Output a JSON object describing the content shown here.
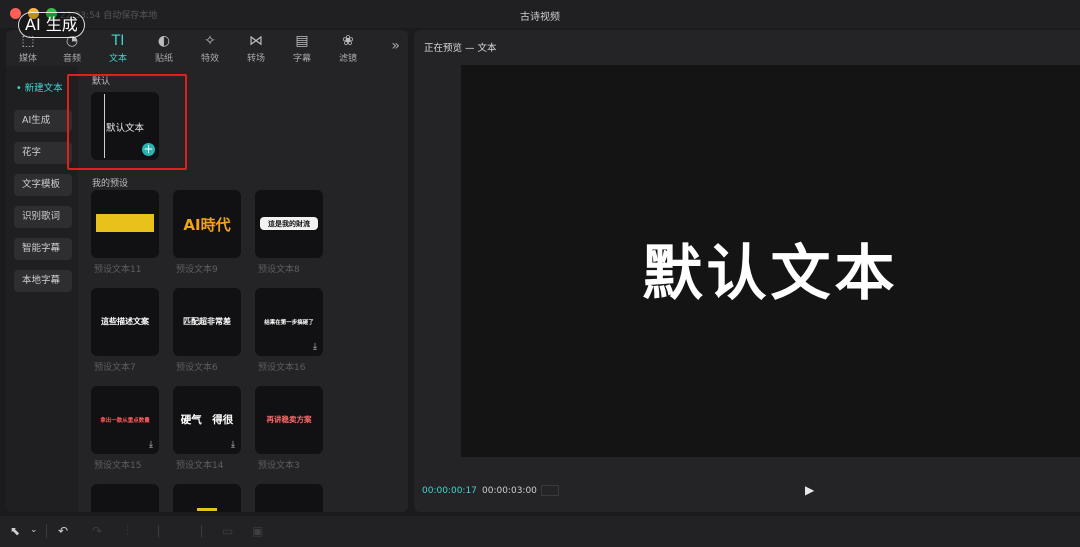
{
  "window": {
    "title": "古诗视频",
    "save_status": "22:33:54 自动保存本地",
    "watermark": "AI 生成"
  },
  "toolbar": {
    "tabs": [
      {
        "icon": "media-icon",
        "glyph": "⬚",
        "label": "媒体"
      },
      {
        "icon": "audio-icon",
        "glyph": "◔",
        "label": "音频"
      },
      {
        "icon": "text-icon",
        "glyph": "TI",
        "label": "文本",
        "active": true
      },
      {
        "icon": "sticker-icon",
        "glyph": "◐",
        "label": "贴纸"
      },
      {
        "icon": "effects-icon",
        "glyph": "✧",
        "label": "特效"
      },
      {
        "icon": "transition-icon",
        "glyph": "⋈",
        "label": "转场"
      },
      {
        "icon": "subtitle-icon",
        "glyph": "▤",
        "label": "字幕"
      },
      {
        "icon": "filter-icon",
        "glyph": "❀",
        "label": "滤镜"
      }
    ],
    "more": "»"
  },
  "sidebar": {
    "items": [
      {
        "label": "• 新建文本",
        "active": true
      },
      {
        "label": "AI生成"
      },
      {
        "label": "花字"
      },
      {
        "label": "文字模板"
      },
      {
        "label": "识别歌词"
      },
      {
        "label": "智能字幕"
      },
      {
        "label": "本地字幕"
      }
    ]
  },
  "content": {
    "default_section": "默认",
    "default_card_text": "默认文本",
    "add_symbol": "+",
    "presets_section": "我的预设",
    "presets": [
      {
        "preview": "",
        "caption": "预设文本11"
      },
      {
        "preview": "AI時代",
        "caption": "预设文本9"
      },
      {
        "preview": "這是我的財流",
        "caption": "预设文本8"
      },
      {
        "preview": "這些描述文案",
        "caption": "预设文本7"
      },
      {
        "preview": "匹配超非常差",
        "caption": "预设文本6"
      },
      {
        "preview": "结果在第一步搞砸了",
        "caption": "预设文本16"
      },
      {
        "preview": "拿出一款从重点数量",
        "caption": "预设文本15"
      },
      {
        "preview": "硬气　得很",
        "caption": "预设文本14"
      },
      {
        "preview": "再讲稳卖方案",
        "caption": "预设文本3"
      }
    ],
    "download_glyph": "⤓"
  },
  "preview": {
    "title": "正在预览 — 文本",
    "canvas_text": "默认文本",
    "time_current": "00:00:00:17",
    "time_total": "00:00:03:00",
    "play_glyph": "▶"
  },
  "bottom_toolbar": {
    "select_glyph": "⬉",
    "dropdown_glyph": "⌄",
    "undo_glyph": "↶"
  },
  "colors": {
    "accent": "#3fd6d0",
    "highlight": "#e02020",
    "preset_yellow": "#e8c21a",
    "preset_orange": "#f0a21a"
  }
}
